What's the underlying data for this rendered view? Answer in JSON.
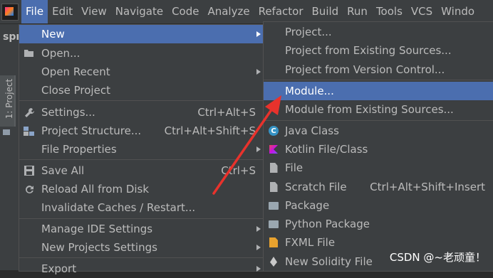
{
  "menubar": {
    "items": [
      "File",
      "Edit",
      "View",
      "Navigate",
      "Code",
      "Analyze",
      "Refactor",
      "Build",
      "Run",
      "Tools",
      "VCS",
      "Windo"
    ],
    "active_index": 0
  },
  "left_panel": {
    "project_name_fragment": "spr",
    "tool_window_label": "1: Project"
  },
  "file_menu": {
    "items": [
      {
        "label": "New",
        "icon": "",
        "shortcut": "",
        "submenu": true
      },
      {
        "label": "Open...",
        "icon": "folder-open-icon",
        "shortcut": ""
      },
      {
        "label": "Open Recent",
        "icon": "",
        "shortcut": "",
        "submenu": true
      },
      {
        "label": "Close Project",
        "icon": "",
        "shortcut": ""
      },
      {
        "label": "Settings...",
        "icon": "wrench-icon",
        "shortcut": "Ctrl+Alt+S"
      },
      {
        "label": "Project Structure...",
        "icon": "project-structure-icon",
        "shortcut": "Ctrl+Alt+Shift+S"
      },
      {
        "label": "File Properties",
        "icon": "",
        "shortcut": "",
        "submenu": true
      },
      {
        "label": "Save All",
        "icon": "save-icon",
        "shortcut": "Ctrl+S"
      },
      {
        "label": "Reload All from Disk",
        "icon": "reload-icon",
        "shortcut": ""
      },
      {
        "label": "Invalidate Caches / Restart...",
        "icon": "",
        "shortcut": ""
      },
      {
        "label": "Manage IDE Settings",
        "icon": "",
        "shortcut": "",
        "submenu": true
      },
      {
        "label": "New Projects Settings",
        "icon": "",
        "shortcut": "",
        "submenu": true
      },
      {
        "label": "Export",
        "icon": "",
        "shortcut": "",
        "submenu": true
      }
    ]
  },
  "new_submenu": {
    "items": [
      {
        "label": "Project...",
        "icon": "",
        "shortcut": ""
      },
      {
        "label": "Project from Existing Sources...",
        "icon": "",
        "shortcut": ""
      },
      {
        "label": "Project from Version Control...",
        "icon": "",
        "shortcut": ""
      },
      {
        "label": "Module...",
        "icon": "",
        "shortcut": ""
      },
      {
        "label": "Module from Existing Sources...",
        "icon": "",
        "shortcut": ""
      },
      {
        "label": "Java Class",
        "icon": "java-class-icon",
        "shortcut": ""
      },
      {
        "label": "Kotlin File/Class",
        "icon": "kotlin-icon",
        "shortcut": ""
      },
      {
        "label": "File",
        "icon": "file-icon",
        "shortcut": ""
      },
      {
        "label": "Scratch File",
        "icon": "scratch-file-icon",
        "shortcut": "Ctrl+Alt+Shift+Insert"
      },
      {
        "label": "Package",
        "icon": "package-icon",
        "shortcut": ""
      },
      {
        "label": "Python Package",
        "icon": "python-package-icon",
        "shortcut": ""
      },
      {
        "label": "FXML File",
        "icon": "fxml-file-icon",
        "shortcut": ""
      },
      {
        "label": "New Solidity File",
        "icon": "solidity-icon",
        "shortcut": ""
      }
    ]
  },
  "watermark": "CSDN @~老顽童！",
  "colors": {
    "menu_bg": "#3c3f41",
    "selection": "#4b6eaf",
    "text": "#bbbbbb",
    "annotation_arrow": "#e8322c"
  }
}
